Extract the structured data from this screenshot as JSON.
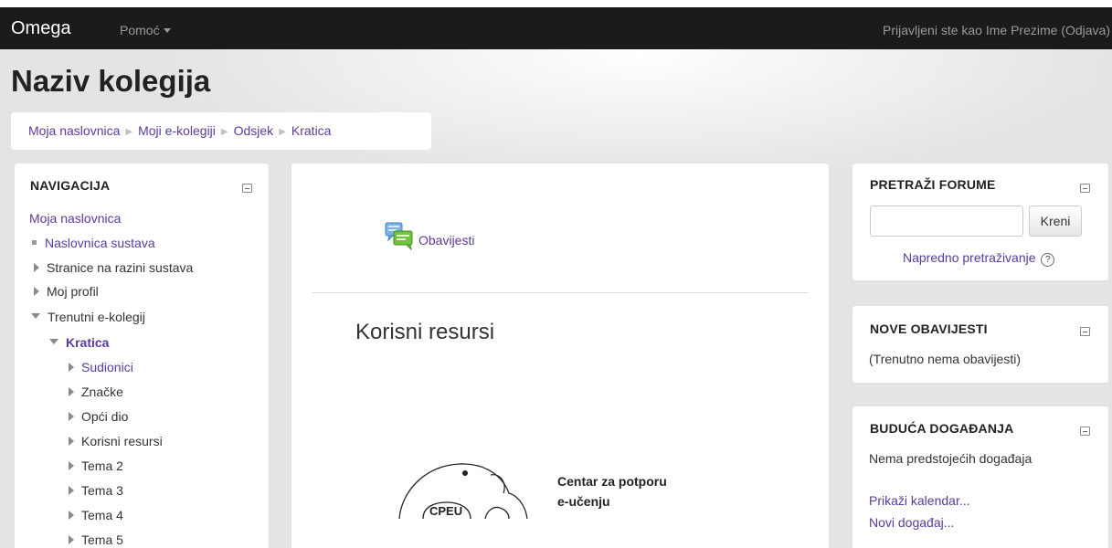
{
  "header": {
    "brand": "Omega",
    "help_menu": "Pomoć",
    "login_text": "Prijavljeni ste kao Ime Prezime",
    "logout_text": "(Odjava)"
  },
  "page_title": "Naziv kolegija",
  "breadcrumb": [
    "Moja naslovnica",
    "Moji e-kolegiji",
    "Odsjek",
    "Kratica"
  ],
  "navigation": {
    "title": "NAVIGACIJA",
    "home": "Moja naslovnica",
    "items": [
      {
        "label": "Naslovnica sustava",
        "icon": "bullet"
      },
      {
        "label": "Stranice na razini sustava",
        "icon": "expand-right"
      },
      {
        "label": "Moj profil",
        "icon": "expand-right"
      },
      {
        "label": "Trenutni e-kolegij",
        "icon": "expanded"
      },
      {
        "label": "Kratica",
        "icon": "expanded"
      },
      {
        "label": "Sudionici",
        "icon": "expand-right"
      },
      {
        "label": "Značke",
        "icon": "expand-right"
      },
      {
        "label": "Opći dio",
        "icon": "expand-right"
      },
      {
        "label": "Korisni resursi",
        "icon": "expand-right"
      },
      {
        "label": "Tema 2",
        "icon": "expand-right"
      },
      {
        "label": "Tema 3",
        "icon": "expand-right"
      },
      {
        "label": "Tema 4",
        "icon": "expand-right"
      },
      {
        "label": "Tema 5",
        "icon": "expand-right"
      }
    ]
  },
  "main": {
    "forum_link": "Obavijesti",
    "section_title": "Korisni resursi",
    "logo_text": "CPEU",
    "logo_caption_line1": "Centar za potporu",
    "logo_caption_line2": "e-učenju"
  },
  "search_forums": {
    "title": "PRETRAŽI FORUME",
    "input_value": "",
    "button": "Kreni",
    "advanced": "Napredno pretraživanje",
    "help_glyph": "?"
  },
  "latest_news": {
    "title": "NOVE OBAVIJESTI",
    "empty_text": "(Trenutno nema obavijesti)"
  },
  "upcoming_events": {
    "title": "BUDUĆA DOGAĐANJA",
    "empty_text": "Nema predstojećih događaja",
    "calendar_link": "Prikaži kalendar...",
    "new_event_link": "Novi događaj..."
  },
  "colors": {
    "navbar": "#1b1b1b",
    "link": "#5b3a9c",
    "brand_text": "#ffffff"
  }
}
